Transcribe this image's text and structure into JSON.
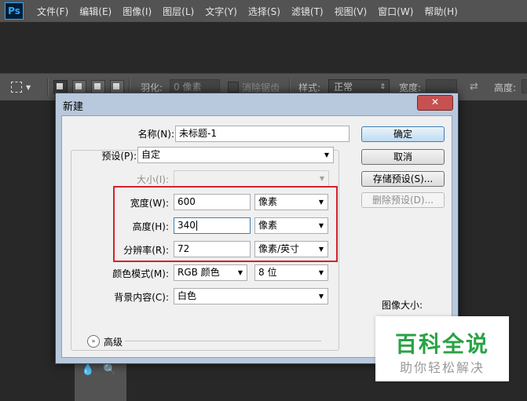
{
  "app": {
    "logo": "Ps"
  },
  "menu": [
    "文件(F)",
    "编辑(E)",
    "图像(I)",
    "图层(L)",
    "文字(Y)",
    "选择(S)",
    "滤镜(T)",
    "视图(V)",
    "窗口(W)",
    "帮助(H)"
  ],
  "options_bar": {
    "feather_label": "羽化:",
    "feather_value": "0 像素",
    "antialias_label": "消除锯齿",
    "style_label": "样式:",
    "style_value": "正常",
    "width_label": "宽度:",
    "height_label": "高度:"
  },
  "dialog": {
    "title": "新建",
    "close_glyph": "✕",
    "name_label": "名称(N):",
    "name_value": "未标题-1",
    "preset_label": "预设(P):",
    "preset_value": "自定",
    "size_label": "大小(I):",
    "width_label": "宽度(W):",
    "width_value": "600",
    "width_unit": "像素",
    "height_label": "高度(H):",
    "height_value": "340",
    "height_unit": "像素",
    "resolution_label": "分辨率(R):",
    "resolution_value": "72",
    "resolution_unit": "像素/英寸",
    "color_mode_label": "颜色模式(M):",
    "color_mode_value": "RGB 颜色",
    "bit_depth_value": "8 位",
    "background_label": "背景内容(C):",
    "background_value": "白色",
    "advanced_label": "高级",
    "image_size_label": "图像大小:",
    "buttons": {
      "ok": "确定",
      "cancel": "取消",
      "save_preset": "存储预设(S)...",
      "delete_preset": "删除预设(D)..."
    }
  },
  "watermark": {
    "title": "百科全说",
    "subtitle": "助你轻松解决"
  },
  "colors": {
    "highlight_box": "#d2232a",
    "dialog_frame": "#b8c9dd",
    "watermark_green": "#2aa245"
  }
}
